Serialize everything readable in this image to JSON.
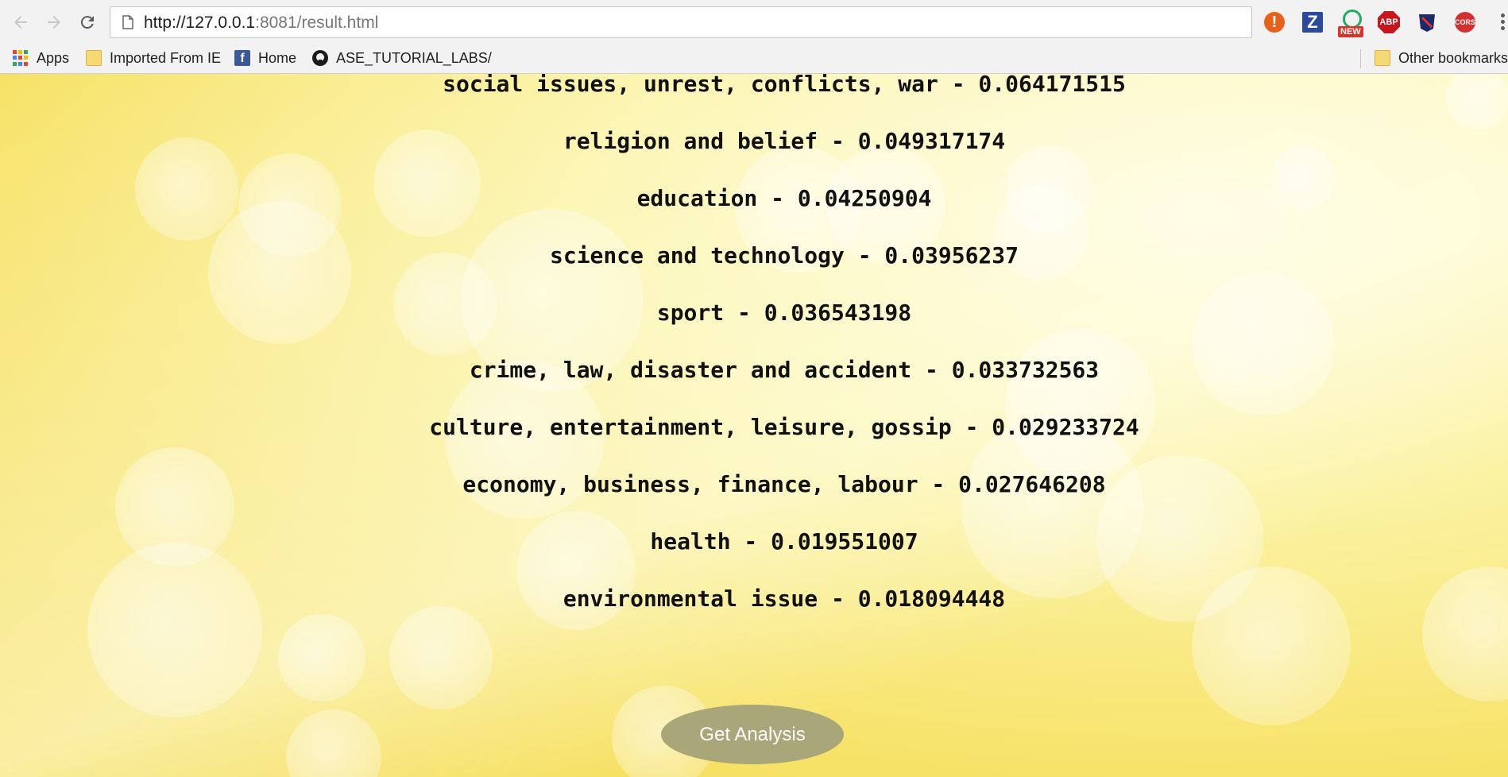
{
  "browser": {
    "url_host": "http://127.0.0.1",
    "url_path": ":8081/result.html",
    "extensions": {
      "alert": "!",
      "z": "Z",
      "new_badge": "NEW",
      "abp": "ABP",
      "cors": "CORS"
    }
  },
  "bookmarks": {
    "apps": "Apps",
    "imported": "Imported From IE",
    "home": "Home",
    "home_icon": "f",
    "ase": "ASE_TUTORIAL_LABS/",
    "other": "Other bookmarks"
  },
  "results": [
    {
      "label": "social issues, unrest, conflicts, war - 0.064171515"
    },
    {
      "label": "religion and belief - 0.049317174"
    },
    {
      "label": "education - 0.04250904"
    },
    {
      "label": "science and technology - 0.03956237"
    },
    {
      "label": "sport - 0.036543198"
    },
    {
      "label": "crime, law, disaster and accident - 0.033732563"
    },
    {
      "label": "culture, entertainment, leisure, gossip - 0.029233724"
    },
    {
      "label": "economy, business, finance, labour - 0.027646208"
    },
    {
      "label": "health - 0.019551007"
    },
    {
      "label": "environmental issue - 0.018094448"
    }
  ],
  "button": {
    "label": "Get Analysis"
  },
  "colors": {
    "background": "#f5e05a",
    "button": "#a9a67a",
    "text": "#111111"
  }
}
